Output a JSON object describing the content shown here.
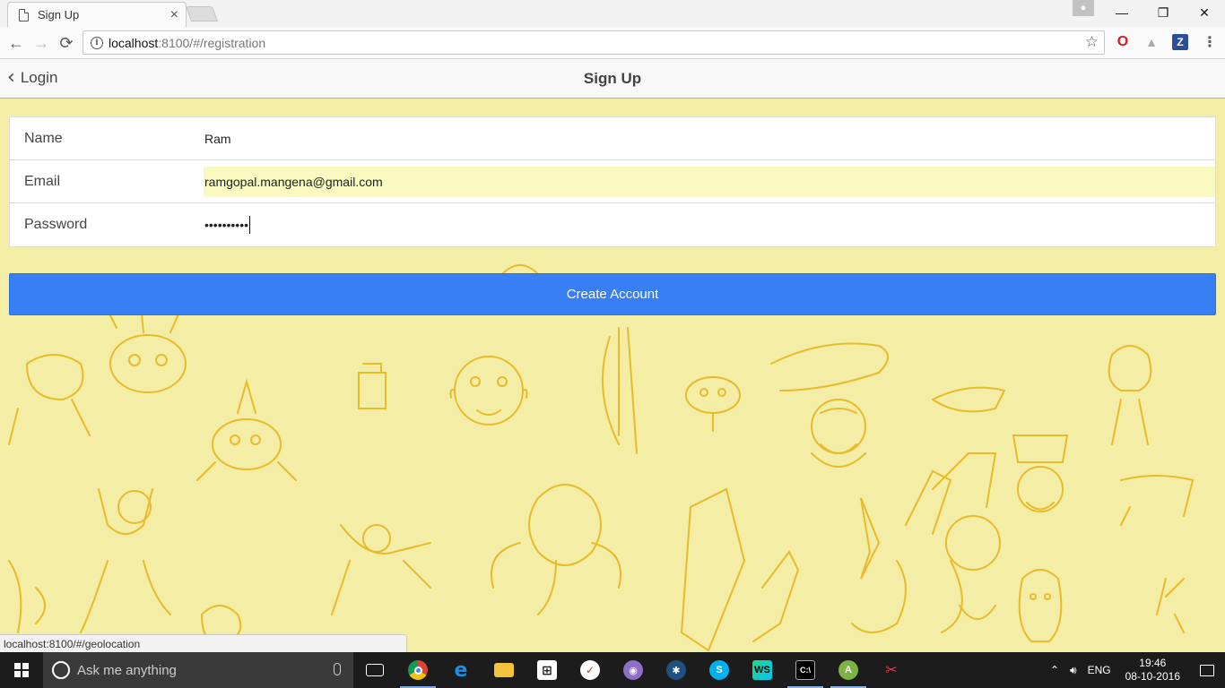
{
  "browser": {
    "tab_title": "Sign Up",
    "tab_close": "×",
    "url_host": "localhost",
    "url_rest": ":8100/#/registration",
    "status_url": "localhost:8100/#/geolocation",
    "nav": {
      "back": "←",
      "forward": "→",
      "reload": "⟳"
    },
    "window": {
      "minimize": "—",
      "restore": "❐",
      "close": "✕"
    },
    "extensions": [
      "opera-icon",
      "drive-icon",
      "z-extension-icon",
      "menu-icon"
    ]
  },
  "app": {
    "back_label": "Login",
    "title": "Sign Up",
    "form": {
      "name_label": "Name",
      "name_value": "Ram",
      "email_label": "Email",
      "email_value": "ramgopal.mangena@gmail.com",
      "password_label": "Password",
      "password_value": "••••••••••"
    },
    "create_button": "Create Account",
    "colors": {
      "background": "#f4eda5",
      "doodle": "#e8bb2a",
      "primary_button": "#387ef5",
      "autofill": "#fafac0"
    }
  },
  "taskbar": {
    "search_placeholder": "Ask me anything",
    "apps": [
      "task-view",
      "chrome",
      "edge",
      "file-explorer",
      "store",
      "news",
      "github-desktop",
      "sourcetree",
      "skype",
      "webstorm",
      "command-prompt",
      "android-studio",
      "snipping-tool"
    ],
    "language": "ENG",
    "time": "19:46",
    "date": "08-10-2016"
  }
}
